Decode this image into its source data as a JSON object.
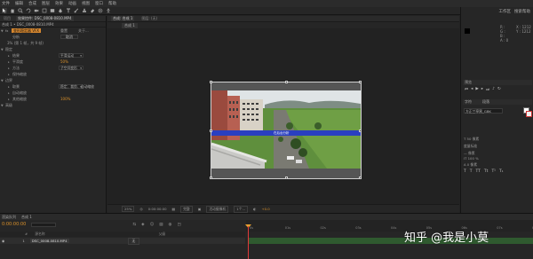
{
  "menu": [
    "文件",
    "编辑",
    "合成",
    "图层",
    "效果",
    "动画",
    "视图",
    "窗口",
    "帮助"
  ],
  "toolbar": {
    "workspace": "工作区",
    "search_label": "搜索帮助"
  },
  "left_panel": {
    "tabs": [
      "项目",
      "效果控件: DSC_0008-0810.MP4"
    ],
    "source": "合成 1 • DSC_0008-0810.MP4",
    "effect_name": "变形稳定器 VFX",
    "reset_label": "重置",
    "about_label": "关于...",
    "fx_label": "fx",
    "analyze_label": "分析",
    "cancel_label": "取消",
    "status": "3% (第 1 帧，共 9 帧)",
    "rows": [
      {
        "label": "稳定",
        "indent": 1
      },
      {
        "label": "结果",
        "indent": 2,
        "dropdown": "平滑运动"
      },
      {
        "label": "平滑度",
        "indent": 2,
        "value": "50%"
      },
      {
        "label": "方法",
        "indent": 2,
        "dropdown": "子空间变形"
      },
      {
        "label": "保持缩放",
        "indent": 2
      },
      {
        "label": "边界",
        "indent": 1
      },
      {
        "label": "取景",
        "indent": 2,
        "dropdown": "稳定、裁剪、自动缩放"
      },
      {
        "label": "自动缩放",
        "indent": 2
      },
      {
        "label": "其他缩放",
        "indent": 2,
        "value": "100%"
      },
      {
        "label": "高级",
        "indent": 1
      }
    ]
  },
  "comp": {
    "tabs": [
      "合成: 合成 1",
      "图层: (无)"
    ],
    "sub_tab": "合成 1",
    "bottom": {
      "zoom": "25%",
      "timecode": "0:00:00:00",
      "resolution": "完整",
      "camera": "活动摄像机",
      "views": "1个...",
      "exposure": "+0.0"
    },
    "overlay_text": "在后台分析"
  },
  "right_panel": {
    "workspace": "工作区",
    "search": "搜索帮助",
    "info_lines": [
      "R :",
      "G :",
      "B :",
      "A : 0",
      "X : 1212",
      "Y : 1212"
    ],
    "preview_tab": "预览",
    "char_tabs": [
      "字符",
      "段落"
    ],
    "font": "方正兰亭黑_GBK",
    "char_rows": [
      {
        "text": "T 50 像素",
        "accent": ""
      },
      {
        "text": "度量标准",
        "accent": ""
      },
      {
        "text": "— 像素",
        "accent": ""
      },
      {
        "text": "IT 100 %",
        "accent": "100 %"
      },
      {
        "text": "A 0 像素",
        "accent": "0 像素"
      }
    ],
    "text_styles": [
      "T",
      "T",
      "TT",
      "Tt",
      "T¹",
      "T₁"
    ]
  },
  "timeline": {
    "tabs": [
      "渲染队列",
      "合成 1"
    ],
    "current_time": "0:00:00:00",
    "columns": [
      "#",
      "源名称",
      "父级"
    ],
    "layer": {
      "index": "1",
      "name": "DSC_0008-0810.MP4",
      "parent": "无"
    },
    "ruler_ticks": [
      "0s",
      "01s",
      "02s",
      "03s",
      "04s",
      "05s",
      "06s",
      "07s",
      "08s"
    ]
  },
  "watermark": "知乎 @我是小莫",
  "colors": {
    "accent_orange": "#d9902a",
    "analysis_bar": "#2a3fc0",
    "timeline_bar": "#2f5a2f",
    "cti": "#e03a3a"
  }
}
